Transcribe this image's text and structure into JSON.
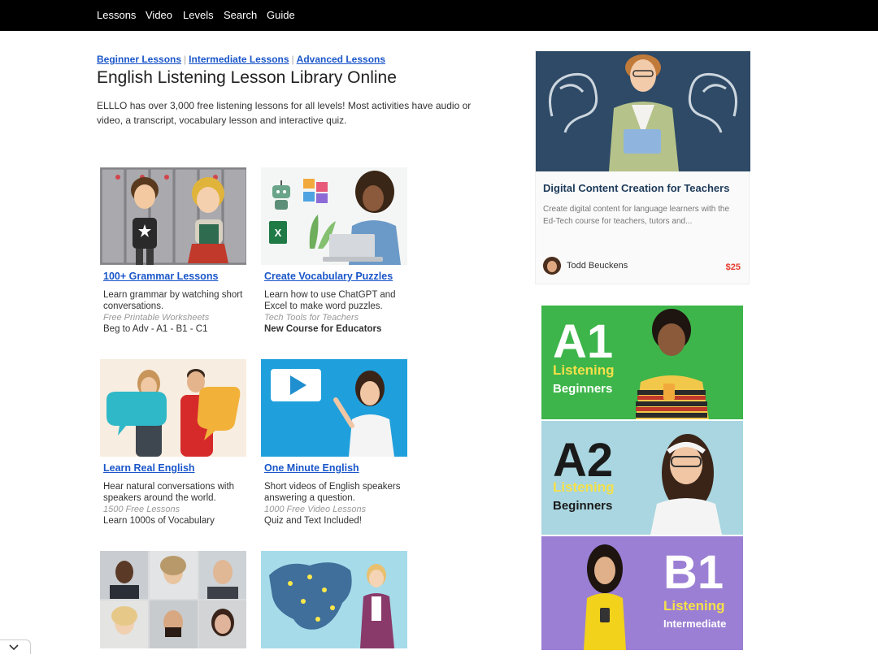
{
  "nav": {
    "items": [
      "Lessons",
      "Video",
      "Levels",
      "Search",
      "Guide"
    ]
  },
  "levels": {
    "beginner": "Beginner Lessons",
    "intermediate": "Intermediate Lessons",
    "advanced": "Advanced Lessons",
    "separator": "|"
  },
  "page_title": "English Listening Lesson Library Online",
  "intro": "ELLLO has over 3,000 free listening lessons for all levels! Most activities have audio or video, a transcript, vocabulary lesson and interactive quiz.",
  "cards": [
    {
      "title": "100+ Grammar Lessons",
      "desc": "Learn grammar by watching short conversations.",
      "sub": "Free Printable Worksheets",
      "extra": "Beg to Adv - A1 - B1 - C1"
    },
    {
      "title": "Create Vocabulary Puzzles",
      "desc": "Learn how to use ChatGPT and Excel to make word puzzles.",
      "sub": "Tech Tools for Teachers",
      "extra": "New Course for Educators"
    },
    {
      "title": "Learn Real English",
      "desc": "Hear natural conversations with speakers around the world.",
      "sub": "1500 Free Lessons",
      "extra": "Learn 1000s of Vocabulary"
    },
    {
      "title": "One Minute English",
      "desc": "Short videos of English speakers answering a question.",
      "sub": "1000 Free Video Lessons",
      "extra": "Quiz and Text Included!"
    }
  ],
  "ad": {
    "title": "Digital Content Creation for Teachers",
    "desc": "Create digital content for language learners with the Ed-Tech course for teachers, tutors and...",
    "author": "Todd Beuckens",
    "price": "$25"
  },
  "banners": [
    {
      "level": "A1",
      "line1": "Listening",
      "line2": "Beginners"
    },
    {
      "level": "A2",
      "line1": "Listening",
      "line2": "Beginners"
    },
    {
      "level": "B1",
      "line1": "Listening",
      "line2": "Intermediate"
    }
  ],
  "colors": {
    "link": "#1a56c9",
    "nav_bg": "#000000",
    "price": "#e53b2c",
    "a1_bg": "#3db54a",
    "a2_bg": "#a9d6e0",
    "b1_bg": "#9b7fd4"
  }
}
